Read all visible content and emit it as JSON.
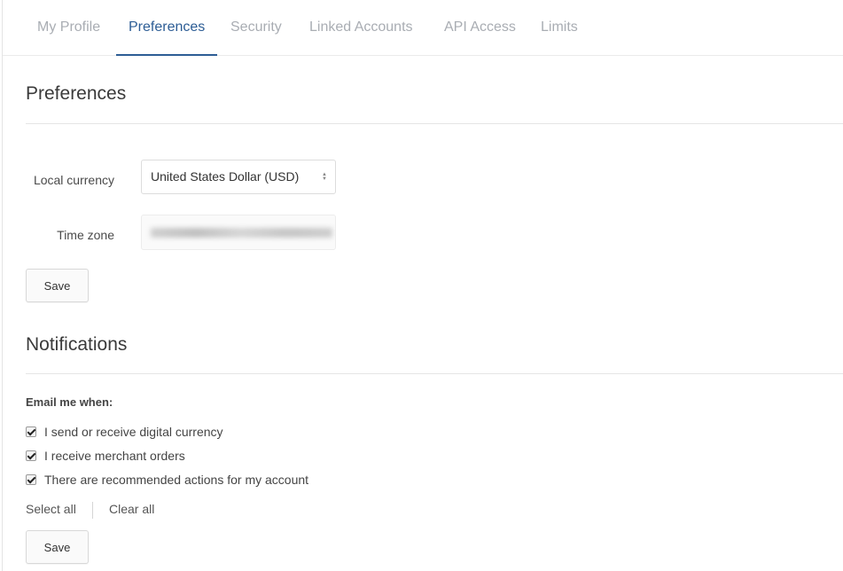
{
  "tabs": [
    {
      "label": "My Profile",
      "active": false
    },
    {
      "label": "Preferences",
      "active": true
    },
    {
      "label": "Security",
      "active": false
    },
    {
      "label": "Linked Accounts",
      "active": false
    },
    {
      "label": "API Access",
      "active": false
    },
    {
      "label": "Limits",
      "active": false
    }
  ],
  "preferences": {
    "title": "Preferences",
    "local_currency_label": "Local currency",
    "local_currency_value": "United States Dollar (USD)",
    "time_zone_label": "Time zone",
    "time_zone_value": "",
    "save_label": "Save"
  },
  "notifications": {
    "title": "Notifications",
    "email_label": "Email me when:",
    "options": [
      {
        "label": "I send or receive digital currency",
        "checked": true
      },
      {
        "label": "I receive merchant orders",
        "checked": true
      },
      {
        "label": "There are recommended actions for my account",
        "checked": true
      }
    ],
    "select_all_label": "Select all",
    "clear_all_label": "Clear all",
    "save_label": "Save"
  },
  "colors": {
    "accent": "#2d5d95",
    "tab_inactive": "#a9adb3"
  }
}
